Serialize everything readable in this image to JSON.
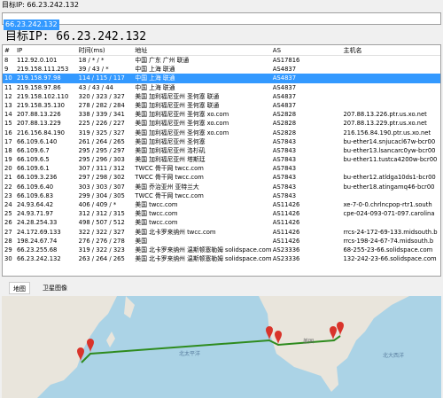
{
  "window_title": "目标IP: 66.23.242.132",
  "search_value": "66.23.242.132",
  "heading": "目标IP:  66.23.242.132",
  "columns": [
    "#",
    "IP",
    "时间(ms)",
    "地址",
    "AS",
    "主机名"
  ],
  "rows": [
    {
      "n": "8",
      "ip": "112.92.0.101",
      "time": "18 / * / *",
      "addr": "中国 广东 广州 联通",
      "as": "AS17816",
      "host": ""
    },
    {
      "n": "9",
      "ip": "219.158.111.253",
      "time": "39 / 43 / *",
      "addr": "中国 上海 联通",
      "as": "AS4837",
      "host": ""
    },
    {
      "n": "10",
      "ip": "219.158.97.98",
      "time": "114 / 115 / 117",
      "addr": "中国 上海 联通",
      "as": "AS4837",
      "host": ""
    },
    {
      "n": "11",
      "ip": "219.158.97.86",
      "time": "43 / 43 / 44",
      "addr": "中国 上海 联通",
      "as": "AS4837",
      "host": ""
    },
    {
      "n": "12",
      "ip": "219.158.102.110",
      "time": "320 / 323 / 327",
      "addr": "美国 加利福尼亚州 圣何塞 联通",
      "as": "AS4837",
      "host": ""
    },
    {
      "n": "13",
      "ip": "219.158.35.130",
      "time": "278 / 282 / 284",
      "addr": "美国 加利福尼亚州 圣何塞 联通",
      "as": "AS4837",
      "host": ""
    },
    {
      "n": "14",
      "ip": "207.88.13.226",
      "time": "338 / 339 / 341",
      "addr": "美国 加利福尼亚州 圣何塞 xo.com",
      "as": "AS2828",
      "host": "207.88.13.226.ptr.us.xo.net"
    },
    {
      "n": "15",
      "ip": "207.88.13.229",
      "time": "225 / 226 / 227",
      "addr": "美国 加利福尼亚州 圣何塞 xo.com",
      "as": "AS2828",
      "host": "207.88.13.229.ptr.us.xo.net"
    },
    {
      "n": "16",
      "ip": "216.156.84.190",
      "time": "319 / 325 / 327",
      "addr": "美国 加利福尼亚州 圣何塞 xo.com",
      "as": "AS2828",
      "host": "216.156.84.190.ptr.us.xo.net"
    },
    {
      "n": "17",
      "ip": "66.109.6.140",
      "time": "261 / 264 / 265",
      "addr": "美国 加利福尼亚州 圣何塞",
      "as": "AS7843",
      "host": "bu-ether14.snjucacl67w-bcr00"
    },
    {
      "n": "18",
      "ip": "66.109.6.7",
      "time": "295 / 295 / 297",
      "addr": "美国 加利福尼亚州 洛杉矶",
      "as": "AS7843",
      "host": "bu-ether13.lsancarc0yw-bcr00"
    },
    {
      "n": "19",
      "ip": "66.109.6.5",
      "time": "295 / 296 / 303",
      "addr": "美国 加利福尼亚州 塔斯廷",
      "as": "AS7843",
      "host": "bu-ether11.tustca4200w-bcr00"
    },
    {
      "n": "20",
      "ip": "66.109.6.1",
      "time": "307 / 311 / 312",
      "addr": "TWCC 骨干网 twcc.com",
      "as": "AS7843",
      "host": ""
    },
    {
      "n": "21",
      "ip": "66.109.3.236",
      "time": "297 / 298 / 302",
      "addr": "TWCC 骨干网 twcc.com",
      "as": "AS7843",
      "host": "bu-ether12.atldga10ds1-bcr00"
    },
    {
      "n": "22",
      "ip": "66.109.6.40",
      "time": "303 / 303 / 307",
      "addr": "美国 乔治亚州 亚特兰大",
      "as": "AS7843",
      "host": "bu-ether18.atingamq46-bcr00"
    },
    {
      "n": "23",
      "ip": "66.109.6.83",
      "time": "299 / 304 / 305",
      "addr": "TWCC 骨干网 twcc.com",
      "as": "AS7843",
      "host": ""
    },
    {
      "n": "24",
      "ip": "24.93.64.42",
      "time": "406 / 409 / *",
      "addr": "美国 twcc.com",
      "as": "AS11426",
      "host": "xe-7-0-0.chrlncpop-rtr1.south"
    },
    {
      "n": "25",
      "ip": "24.93.71.97",
      "time": "312 / 312 / 315",
      "addr": "美国 twcc.com",
      "as": "AS11426",
      "host": "cpe-024-093-071-097.carolina"
    },
    {
      "n": "26",
      "ip": "24.28.254.33",
      "time": "498 / 507 / 512",
      "addr": "美国 twcc.com",
      "as": "AS11426",
      "host": ""
    },
    {
      "n": "27",
      "ip": "24.172.69.133",
      "time": "322 / 322 / 327",
      "addr": "美国 北卡罗来纳州 twcc.com",
      "as": "AS11426",
      "host": "rrcs-24-172-69-133.midsouth.b"
    },
    {
      "n": "28",
      "ip": "198.24.67.74",
      "time": "276 / 276 / 278",
      "addr": "美国",
      "as": "AS11426",
      "host": "rrcs-198-24-67-74.midsouth.b"
    },
    {
      "n": "29",
      "ip": "66.23.255.68",
      "time": "319 / 322 / 323",
      "addr": "美国 北卡罗来纳州 温斯顿塞勒姆 solidspace.com",
      "as": "AS23336",
      "host": "68-255-23-66.solidspace.com"
    },
    {
      "n": "30",
      "ip": "66.23.242.132",
      "time": "263 / 264 / 265",
      "addr": "美国 北卡罗来纳州 温斯顿塞勒姆 solidspace.com",
      "as": "AS23336",
      "host": "132-242-23-66.solidspace.com"
    }
  ],
  "selected_row": 2,
  "tabs": {
    "map": "地图",
    "satellite": "卫星图像"
  },
  "map": {
    "ocean_label": "北太平洋",
    "atlantic_label": "北大西洋",
    "usa_label": "美国"
  },
  "colors": {
    "selection": "#3399ff",
    "route": "#2e8b1e",
    "pin": "#d9342b",
    "water": "#abd3e6",
    "land": "#e9e5dc"
  }
}
